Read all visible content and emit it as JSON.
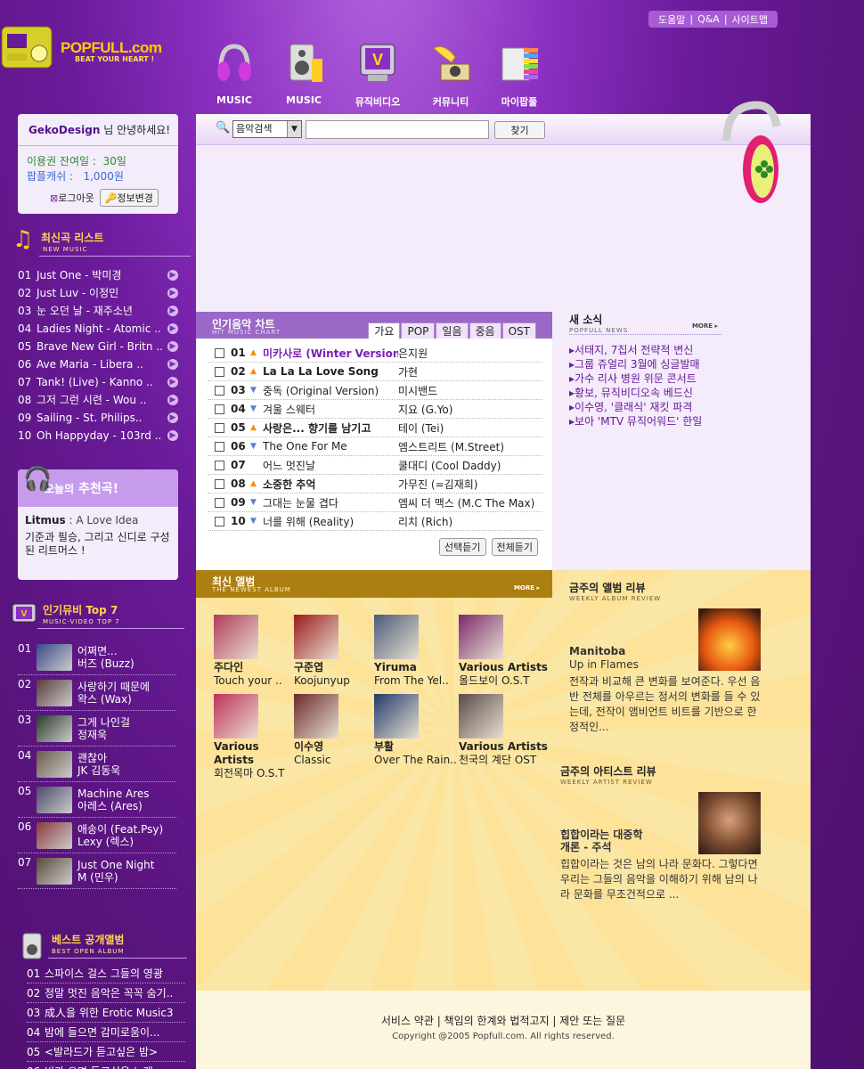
{
  "brand": {
    "name": "POPFULL.com",
    "slogan": "BEAT YOUR HEART !"
  },
  "topbar": [
    "도움말",
    "Q&A",
    "사이트맵"
  ],
  "nav": [
    {
      "label": "MUSIC",
      "icon": "headphones-icon"
    },
    {
      "label": "MUSIC",
      "icon": "speaker-icon"
    },
    {
      "label": "뮤직비디오",
      "icon": "tv-icon"
    },
    {
      "label": "커뮤니티",
      "icon": "gramophone-icon"
    },
    {
      "label": "마이팝풀",
      "icon": "cd-stack-icon"
    }
  ],
  "login": {
    "user": "GekoDesign",
    "greeting": "님 안녕하세요!",
    "pass_label": "이용권 잔여일 :",
    "pass_value": "30일",
    "cash_label": "팝플캐쉬 :",
    "cash_value": "1,000원",
    "logout": "로그아웃",
    "edit": "정보변경"
  },
  "new_music": {
    "title": "최신곡 리스트",
    "sub": "NEW MUSIC",
    "items": [
      {
        "n": "01",
        "t": "Just One - 박미경"
      },
      {
        "n": "02",
        "t": "Just Luv - 이정민"
      },
      {
        "n": "03",
        "t": "눈 오던 날 - 재주소년"
      },
      {
        "n": "04",
        "t": "Ladies Night - Atomic .."
      },
      {
        "n": "05",
        "t": "Brave New Girl - Britn .."
      },
      {
        "n": "06",
        "t": "Ave Maria - Libera .."
      },
      {
        "n": "07",
        "t": "Tank! (Live) - Kanno .."
      },
      {
        "n": "08",
        "t": "그저 그런 시련 - Wou .."
      },
      {
        "n": "09",
        "t": "Sailing - St. Philips.."
      },
      {
        "n": "10",
        "t": "Oh Happyday - 103rd .."
      }
    ]
  },
  "today": {
    "title_a": "오늘의",
    "title_b": "추천곡!",
    "artist": "Litmus",
    "album": ": A Love Idea",
    "desc": "기준과 필승, 그리고 신디로 구성된 리트머스 !"
  },
  "mv_top": {
    "title": "인기뮤비 Top 7",
    "sub": "MUSIC-VIDEO TOP 7",
    "items": [
      {
        "n": "01",
        "t": "어쩌면...",
        "a": "버즈 (Buzz)"
      },
      {
        "n": "02",
        "t": "사랑하기 때문에",
        "a": "왁스 (Wax)"
      },
      {
        "n": "03",
        "t": "그게 나인걸",
        "a": "정재욱"
      },
      {
        "n": "04",
        "t": "괜찮아",
        "a": "JK 김동욱"
      },
      {
        "n": "05",
        "t": "Machine Ares",
        "a": "아레스 (Ares)"
      },
      {
        "n": "06",
        "t": "애송이 (Feat.Psy)",
        "a": "Lexy (렉스)"
      },
      {
        "n": "07",
        "t": "Just One Night",
        "a": "M (민우)"
      }
    ]
  },
  "best": {
    "title": "베스트 공개앨범",
    "sub": "BEST OPEN ALBUM",
    "items": [
      {
        "n": "01",
        "t": "스파이스 걸스 그들의 영광"
      },
      {
        "n": "02",
        "t": "정말 멋진 음악은 꼭꼭 숨기.."
      },
      {
        "n": "03",
        "t": "成人을 위한 Erotic Music3"
      },
      {
        "n": "04",
        "t": "밤에 들으면 감미로움이..."
      },
      {
        "n": "05",
        "t": "<발라드가 듣고싶은 밤>"
      },
      {
        "n": "06",
        "t": "비가 오면 듣고싶은 노래"
      }
    ]
  },
  "search": {
    "select": "음악검색",
    "value": "",
    "button": "찾기"
  },
  "chart": {
    "title": "인기음악 차트",
    "sub": "HIT MUSIC CHART",
    "tabs": [
      "가요",
      "POP",
      "일음",
      "중음",
      "OST"
    ],
    "rows": [
      {
        "rank": "01",
        "dir": "up",
        "title": "미카사로 (Winter Version)",
        "artist": "은지원",
        "bold": true,
        "purple": true
      },
      {
        "rank": "02",
        "dir": "up",
        "title": "La La La Love Song",
        "artist": "가현",
        "bold": true
      },
      {
        "rank": "03",
        "dir": "dn",
        "title": "중독 (Original Version)",
        "artist": "미시밴드"
      },
      {
        "rank": "04",
        "dir": "dn",
        "title": "겨울 스웨터",
        "artist": "지요 (G.Yo)"
      },
      {
        "rank": "05",
        "dir": "up",
        "title": "사랑은... 향기를 남기고",
        "artist": "테이 (Tei)",
        "bold": true
      },
      {
        "rank": "06",
        "dir": "dn",
        "title": "The One For Me",
        "artist": "엠스트리트 (M.Street)"
      },
      {
        "rank": "07",
        "dir": "",
        "title": "어느 멋진날",
        "artist": "쿨대디 (Cool Daddy)"
      },
      {
        "rank": "08",
        "dir": "up",
        "title": "소중한 추억",
        "artist": "가무진 (=김재희)",
        "bold": true
      },
      {
        "rank": "09",
        "dir": "dn",
        "title": "그대는 눈물 겹다",
        "artist": "엠씨 더 맥스 (M.C The Max)"
      },
      {
        "rank": "10",
        "dir": "dn",
        "title": "너를 위해 (Reality)",
        "artist": "리치 (Rich)"
      }
    ],
    "btn_select": "선택듣기",
    "btn_all": "전체듣기"
  },
  "news": {
    "title": "새 소식",
    "sub": "POPFULL NEWS",
    "more": "MORE",
    "items": [
      "서태지, 7집서 전략적 변신",
      "그룹 쥬얼리 3월에 싱글발매",
      "가수 리사 병원 위문 콘서트",
      "황보, 뮤직비디오속 베드신",
      "이수영, '클래식' 재킷 파격",
      "보아 'MTV 뮤직어워드' 한일"
    ]
  },
  "albums": {
    "title": "최신 앨범",
    "sub": "THE NEWEST ALBUM",
    "more": "MORE",
    "items": [
      {
        "a": "주다인",
        "t": "Touch your ..",
        "c": "#b03a5a"
      },
      {
        "a": "구준엽",
        "t": "Koojunyup",
        "c": "#9b1a1a"
      },
      {
        "a": "Yiruma",
        "t": "From The Yel..",
        "c": "#4a5a7a"
      },
      {
        "a": "Various Artists",
        "t": "올드보이 O.S.T",
        "c": "#7a2a6a"
      },
      {
        "a": "Various Artists",
        "t": "회전목마 O.S.T",
        "c": "#c0305a"
      },
      {
        "a": "이수영",
        "t": "Classic",
        "c": "#6a2a2a"
      },
      {
        "a": "부활",
        "t": "Over The Rain..",
        "c": "#223a6a"
      },
      {
        "a": "Various Artists",
        "t": "천국의 계단 OST",
        "c": "#5a4a4a"
      }
    ]
  },
  "album_review": {
    "title": "금주의 앨범 리뷰",
    "sub": "WEEKLY ALBUM REVIEW",
    "artist": "Manitoba",
    "album": "Up in Flames",
    "text": "전작과 비교해 큰 변화를 보여준다. 우선 음반 전체를 아우르는 정서의 변화를 들 수 있는데, 전작이 앰비언트 비트를 기반으로 한 정적인..."
  },
  "artist_review": {
    "title": "금주의 아티스트 리뷰",
    "sub": "WEEKLY ARTIST REVIEW",
    "head1": "힙합이라는 대중학",
    "head2": "개론 - 주석",
    "text": "힙합이라는 것은 남의 나라 문화다. 그렇다면 우리는 그들의 음악을 이해하기 위해 남의 나라 문화를 무조건적으로 ..."
  },
  "footer": {
    "links": [
      "서비스 약관",
      "책임의 한계와 법적고지",
      "제안 또는 질문"
    ],
    "copy": "Copyright @2005  Popfull.com. All rights reserved."
  },
  "colors": {
    "brand_purple": "#6a1b9a",
    "accent_yellow": "#ffd54a",
    "chart_header": "#9a68c6",
    "album_header": "#ab7f12"
  }
}
